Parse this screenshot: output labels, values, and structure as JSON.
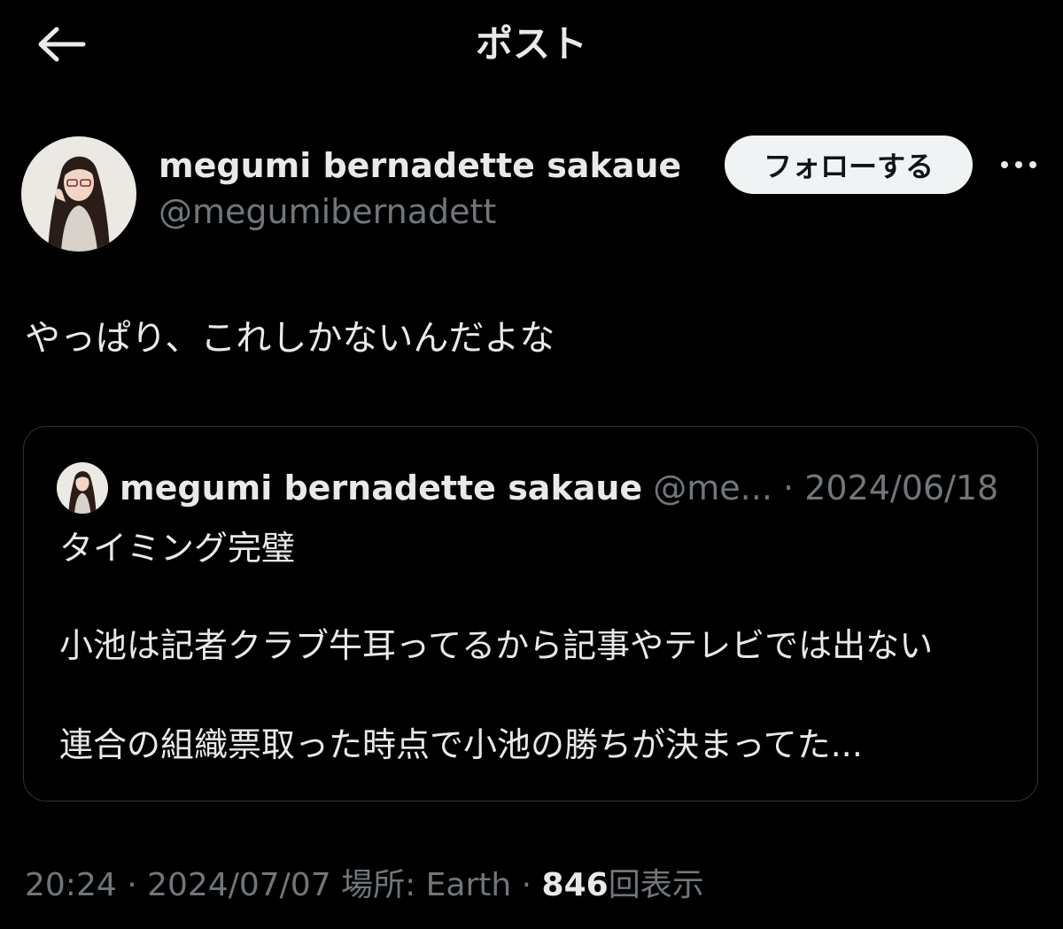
{
  "header": {
    "title": "ポスト",
    "back_icon": "arrow-left-icon"
  },
  "author": {
    "name": "megumi bernadette sakaue",
    "handle": "@megumibernadett",
    "follow_label": "フォローする",
    "more_icon": "more-dots-icon"
  },
  "post": {
    "text": "やっぱり、これしかないんだよな"
  },
  "quote": {
    "name": "megumi bernadette sakaue",
    "handle_truncated": "@me...",
    "separator": "·",
    "date": "2024/06/18",
    "lines": [
      "タイミング完璧",
      "小池は記者クラブ牛耳ってるから記事やテレビでは出ない",
      "連合の組織票取った時点で小池の勝ちが決まってた..."
    ]
  },
  "meta": {
    "time": "20:24",
    "sep1": "·",
    "date": "2024/07/07",
    "location": "場所: Earth",
    "sep2": "·",
    "views_count": "846",
    "views_label": "回表示"
  },
  "colors": {
    "background": "#000000",
    "text": "#e7e9ea",
    "muted": "#71767b",
    "border": "#2f3336",
    "follow_bg": "#eff3f4"
  }
}
